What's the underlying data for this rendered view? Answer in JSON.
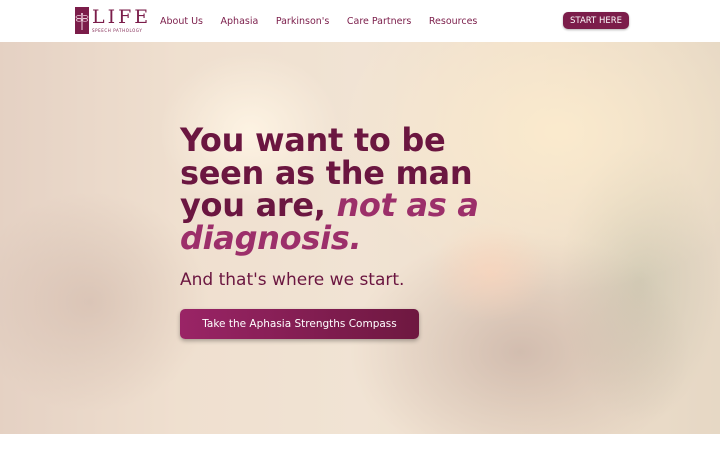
{
  "header": {
    "logo": {
      "word": "LIFE",
      "subtitle": "SPEECH PATHOLOGY",
      "icon": "dragonfly-icon"
    },
    "nav": [
      {
        "label": "About Us"
      },
      {
        "label": "Aphasia"
      },
      {
        "label": "Parkinson's"
      },
      {
        "label": "Care Partners"
      },
      {
        "label": "Resources"
      }
    ],
    "start_button": "START HERE"
  },
  "hero": {
    "headline_plain": "You want to be seen as the man you are, ",
    "headline_accent": "not as a diagnosis",
    "headline_end": ".",
    "subhead": "And that's where we start.",
    "cta": "Take the Aphasia Strengths Compass"
  },
  "colors": {
    "brand": "#7b1d4a",
    "headline": "#6b1640",
    "accent": "#9c2f6a",
    "white": "#ffffff"
  }
}
